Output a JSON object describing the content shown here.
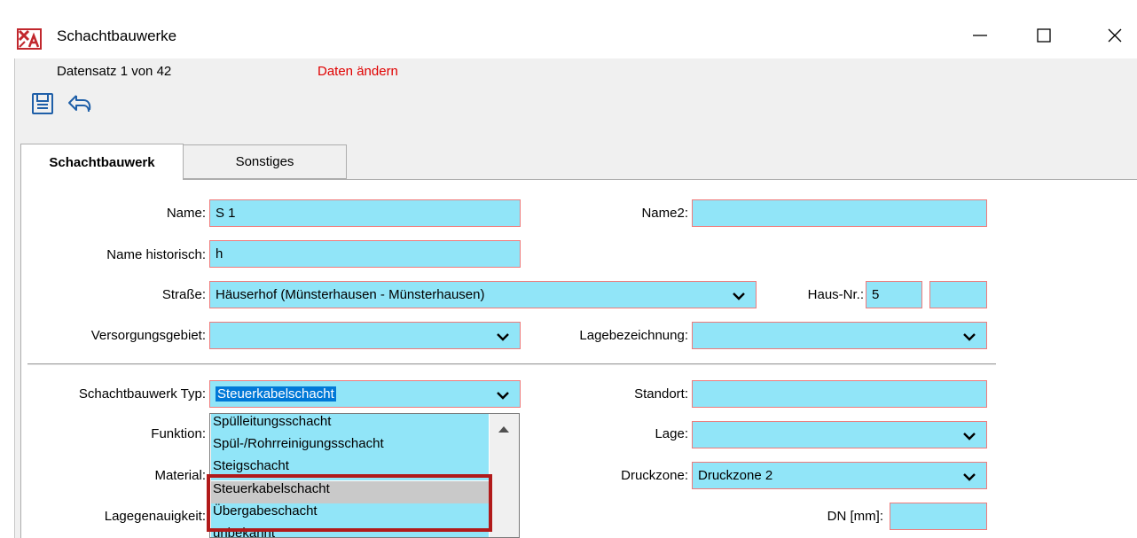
{
  "window": {
    "title": "Schachtbauwerke",
    "app_icon": "app-logo-icon",
    "controls": [
      "minimize-icon",
      "maximize-icon",
      "close-icon"
    ]
  },
  "header": {
    "record_info": "Datensatz 1 von 42",
    "edit_status": "Daten ändern",
    "toolbar": [
      "save-icon",
      "undo-icon"
    ]
  },
  "tabs": [
    {
      "label": "Schachtbauwerk",
      "active": true
    },
    {
      "label": "Sonstiges",
      "active": false
    }
  ],
  "form": {
    "name": {
      "label": "Name:",
      "value": "S 1"
    },
    "name2": {
      "label": "Name2:",
      "value": ""
    },
    "name_historisch": {
      "label": "Name historisch:",
      "value": "h"
    },
    "strasse": {
      "label": "Straße:",
      "value": "Häuserhof (Münsterhausen - Münsterhausen)"
    },
    "haus_nr": {
      "label": "Haus-Nr.:",
      "value": "5",
      "suffix": ""
    },
    "versorgungsgebiet": {
      "label": "Versorgungsgebiet:",
      "value": ""
    },
    "lagebezeichnung": {
      "label": "Lagebezeichnung:",
      "value": ""
    },
    "schachtbauwerk_typ": {
      "label": "Schachtbauwerk Typ:",
      "value": "Steuerkabelschacht"
    },
    "standort": {
      "label": "Standort:",
      "value": ""
    },
    "funktion": {
      "label": "Funktion:"
    },
    "lage": {
      "label": "Lage:",
      "value": ""
    },
    "material": {
      "label": "Material:"
    },
    "druckzone": {
      "label": "Druckzone:",
      "value": "Druckzone 2"
    },
    "lagegenauigkeit": {
      "label": "Lagegenauigkeit:"
    },
    "dn": {
      "label": "DN [mm]:",
      "value": ""
    }
  },
  "dropdown": {
    "options": [
      "Spülleitungsschacht",
      "Spül-/Rohrreinigungsschacht",
      "Steigschacht",
      "Steuerkabelschacht",
      "Übergabeschacht",
      "unbekannt"
    ],
    "selected": "Steuerkabelschacht"
  },
  "colors": {
    "field_bg": "#91e5f8",
    "field_border": "#ef7b7b",
    "status_red": "#e00000",
    "highlight_box": "#b11a1a",
    "selection_blue": "#0078d7"
  }
}
